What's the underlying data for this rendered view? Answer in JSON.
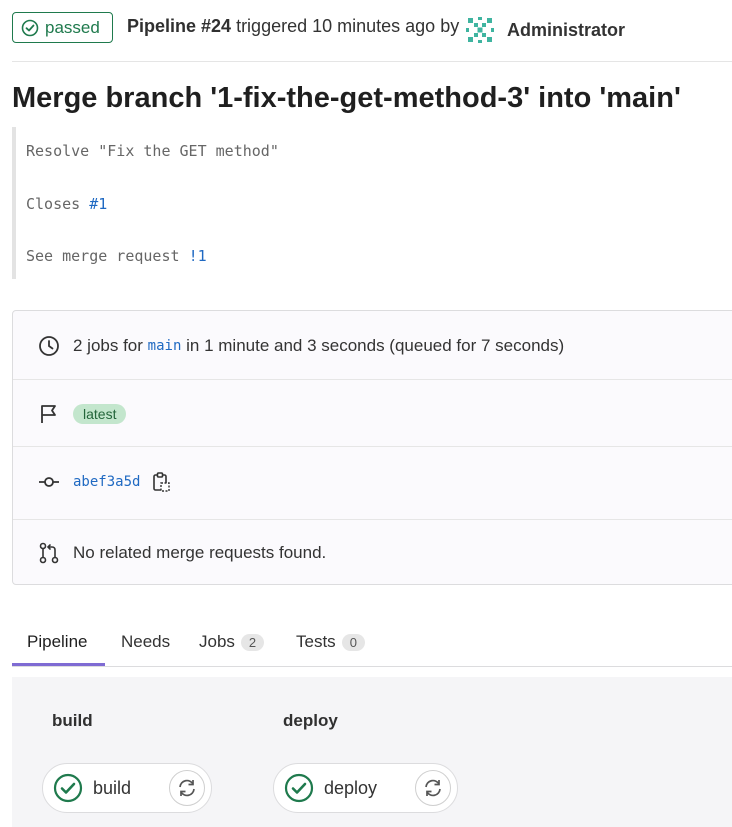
{
  "header": {
    "status": "passed",
    "pipeline_label": "Pipeline #24",
    "triggered_text": " triggered 10 minutes ago by ",
    "user": "Administrator"
  },
  "commit": {
    "title": "Merge branch '1-fix-the-get-method-3' into 'main'",
    "message_line1": "Resolve \"Fix the GET method\"",
    "closes_label": "Closes ",
    "closes_link": "#1",
    "see_mr_label": "See merge request ",
    "mr_link": "!1"
  },
  "info": {
    "jobs_prefix": "2 jobs for ",
    "branch": "main",
    "jobs_suffix": " in 1 minute and 3 seconds (queued for 7 seconds)",
    "tag": "latest",
    "sha": "abef3a5d",
    "related_mr": "No related merge requests found."
  },
  "tabs": [
    {
      "label": "Pipeline",
      "count": null
    },
    {
      "label": "Needs",
      "count": null
    },
    {
      "label": "Jobs",
      "count": "2"
    },
    {
      "label": "Tests",
      "count": "0"
    }
  ],
  "stages": [
    {
      "name": "build",
      "job": "build"
    },
    {
      "name": "deploy",
      "job": "deploy"
    }
  ],
  "colors": {
    "success": "#1f7a4d",
    "link": "#1f69c2",
    "tab_active": "#7f6bd3"
  }
}
